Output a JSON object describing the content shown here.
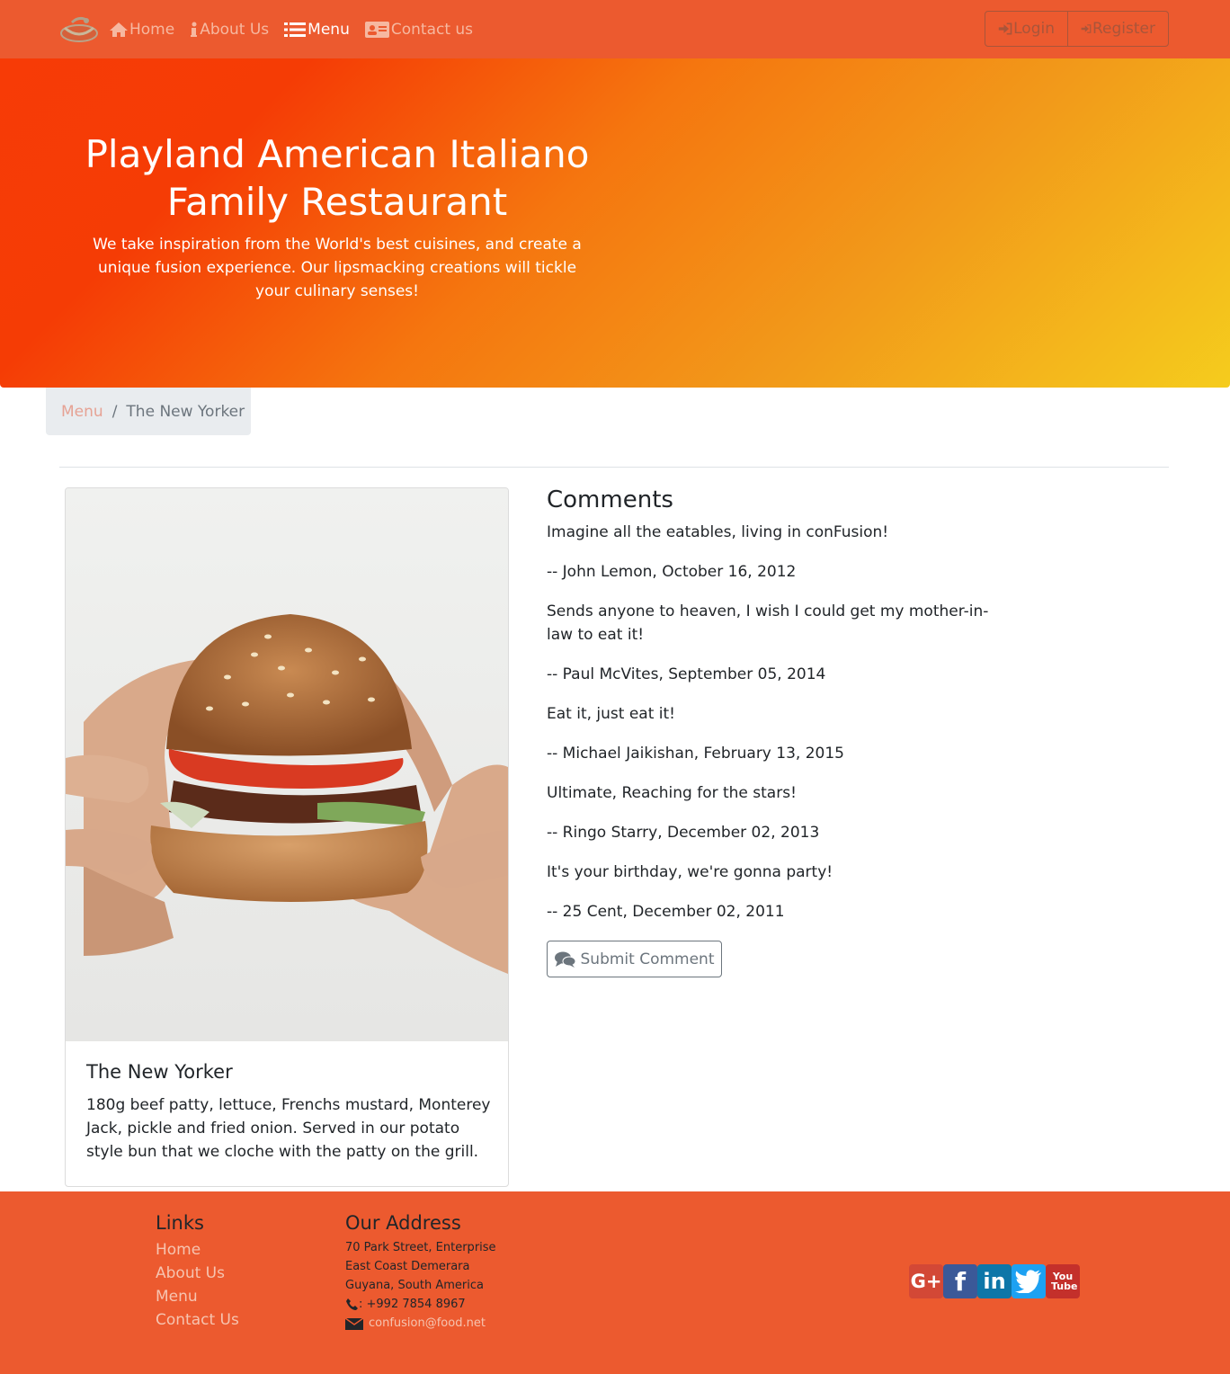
{
  "nav": {
    "items": [
      {
        "label": "Home",
        "icon": "home-icon"
      },
      {
        "label": "About Us",
        "icon": "info-icon"
      },
      {
        "label": "Menu",
        "icon": "list-icon"
      },
      {
        "label": "Contact us",
        "icon": "address-card-icon"
      }
    ],
    "active": "Menu",
    "login_label": "Login",
    "register_label": "Register"
  },
  "hero": {
    "title": "Playland American Italiano Family Restaurant",
    "text": "We take inspiration from the World's best cuisines, and create a unique fusion experience. Our lipsmacking creations will tickle your culinary senses!"
  },
  "breadcrumb": {
    "link": "Menu",
    "separator": "/",
    "active": "The New Yorker"
  },
  "dish": {
    "name": "The New Yorker",
    "description": "180g beef patty, lettuce, Frenchs mustard, Monterey Jack, pickle and fried onion. Served in our potato style bun that we cloche with the patty on the grill."
  },
  "comments": {
    "heading": "Comments",
    "items": [
      {
        "text": "Imagine all the eatables, living in conFusion!",
        "byline": "-- John Lemon,  October 16, 2012"
      },
      {
        "text": "Sends anyone to heaven, I wish I could get my mother-in-law to eat it!",
        "byline": "-- Paul McVites,  September 05, 2014"
      },
      {
        "text": "Eat it, just eat it!",
        "byline": "-- Michael Jaikishan,  February 13, 2015"
      },
      {
        "text": "Ultimate, Reaching for the stars!",
        "byline": "-- Ringo Starry,  December 02, 2013"
      },
      {
        "text": "It's your birthday, we're gonna party!",
        "byline": "-- 25 Cent,  December 02, 2011"
      }
    ],
    "submit_label": "Submit Comment"
  },
  "footer": {
    "links_heading": "Links",
    "links": [
      "Home",
      "About Us",
      "Menu",
      "Contact Us"
    ],
    "address_heading": "Our Address",
    "address_lines": [
      "70 Park Street, Enterprise",
      "East Coast Demerara",
      "Guyana, South America"
    ],
    "phone": ": +992 7854 8967",
    "email": "confusion@food.net",
    "social": [
      {
        "icon": "google-plus-icon",
        "label": "G+",
        "color": "#d34836"
      },
      {
        "icon": "facebook-icon",
        "label": "f",
        "color": "#3b5998"
      },
      {
        "icon": "linkedin-icon",
        "label": "in",
        "color": "#0e76a8"
      },
      {
        "icon": "twitter-icon",
        "label": "t",
        "color": "#1da1f2"
      },
      {
        "icon": "youtube-icon",
        "label": "You Tube",
        "color": "#c4302b"
      }
    ]
  }
}
